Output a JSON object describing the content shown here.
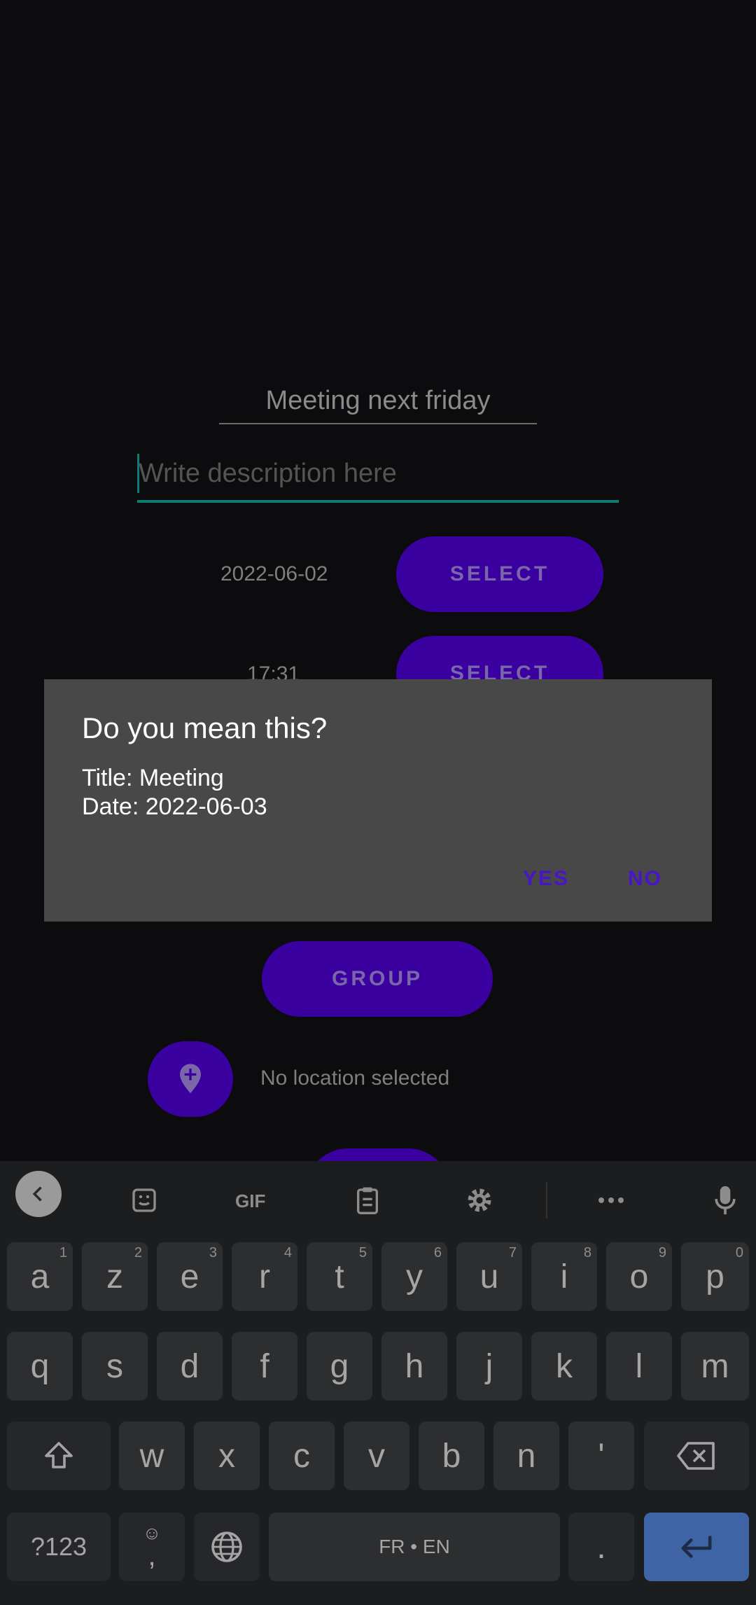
{
  "form": {
    "title_value": "Meeting next friday",
    "description_placeholder": "Write description here",
    "date_value": "2022-06-02",
    "date_button": "SELECT",
    "time_value": "17:31",
    "time_button": "SELECT",
    "group_button": "GROUP",
    "location_text": "No location selected"
  },
  "dialog": {
    "title": "Do you mean this?",
    "line1": "Title: Meeting",
    "line2": "Date: 2022-06-03",
    "yes": "YES",
    "no": "NO"
  },
  "keyboard": {
    "row1": [
      {
        "k": "a",
        "h": "1"
      },
      {
        "k": "z",
        "h": "2"
      },
      {
        "k": "e",
        "h": "3"
      },
      {
        "k": "r",
        "h": "4"
      },
      {
        "k": "t",
        "h": "5"
      },
      {
        "k": "y",
        "h": "6"
      },
      {
        "k": "u",
        "h": "7"
      },
      {
        "k": "i",
        "h": "8"
      },
      {
        "k": "o",
        "h": "9"
      },
      {
        "k": "p",
        "h": "0"
      }
    ],
    "row2": [
      "q",
      "s",
      "d",
      "f",
      "g",
      "h",
      "j",
      "k",
      "l",
      "m"
    ],
    "row3": [
      "w",
      "x",
      "c",
      "v",
      "b",
      "n",
      "'"
    ],
    "sym": "?123",
    "emoji": "☺",
    "comma": ",",
    "space": "FR • EN",
    "period": "."
  }
}
